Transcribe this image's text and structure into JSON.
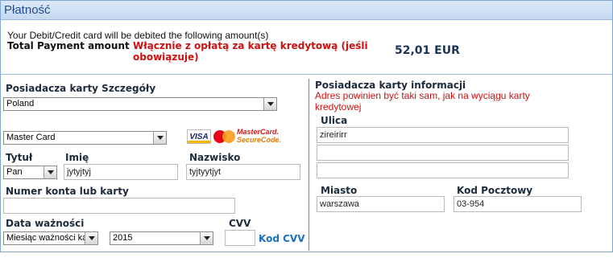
{
  "header": {
    "title": "Płatność"
  },
  "summary": {
    "info": "Your Debit/Credit card will be debited the following amount(s)",
    "total_label": "Total Payment amount",
    "fee_note": "Włącznie z opłatą za kartę kredytową (jeśli obowiązuje)",
    "amount": "52,01 EUR"
  },
  "left": {
    "section_title": "Posiadacza karty Szczegóły",
    "country": "Poland",
    "card_type": "Master Card",
    "logos": {
      "visa": "VISA",
      "mastercard": "MasterCard",
      "mc_small": "MasterCard",
      "mastercard_line1": "MasterCard.",
      "mastercard_line2": "SecureCode."
    },
    "title_label": "Tytuł",
    "title_value": "Pan",
    "first_name_label": "Imię",
    "first_name_value": "jytyjtyj",
    "last_name_label": "Nazwisko",
    "last_name_value": "tyjtyytjyt",
    "card_number_label": "Numer konta lub karty",
    "card_number_value": "",
    "expiry_label": "Data ważności",
    "expiry_month": "Miesiąc ważności karty",
    "expiry_year": "2015",
    "cvv_label": "CVV",
    "cvv_value": "",
    "cvv_link": "Kod CVV"
  },
  "right": {
    "section_title": "Posiadacza karty informacji",
    "address_note": "Adres powinien być taki sam, jak na wyciągu karty kredytowej",
    "street_label": "Ulica",
    "street_line1": "zireirirr",
    "street_line2": "",
    "street_line3": "",
    "city_label": "Miasto",
    "city_value": "warszawa",
    "postcode_label": "Kod Pocztowy",
    "postcode_value": "03-954"
  },
  "colors": {
    "accent": "#1f4f8e",
    "error_red": "#cc1111",
    "link_blue": "#1a6fc1",
    "border": "#7fa6d3"
  }
}
